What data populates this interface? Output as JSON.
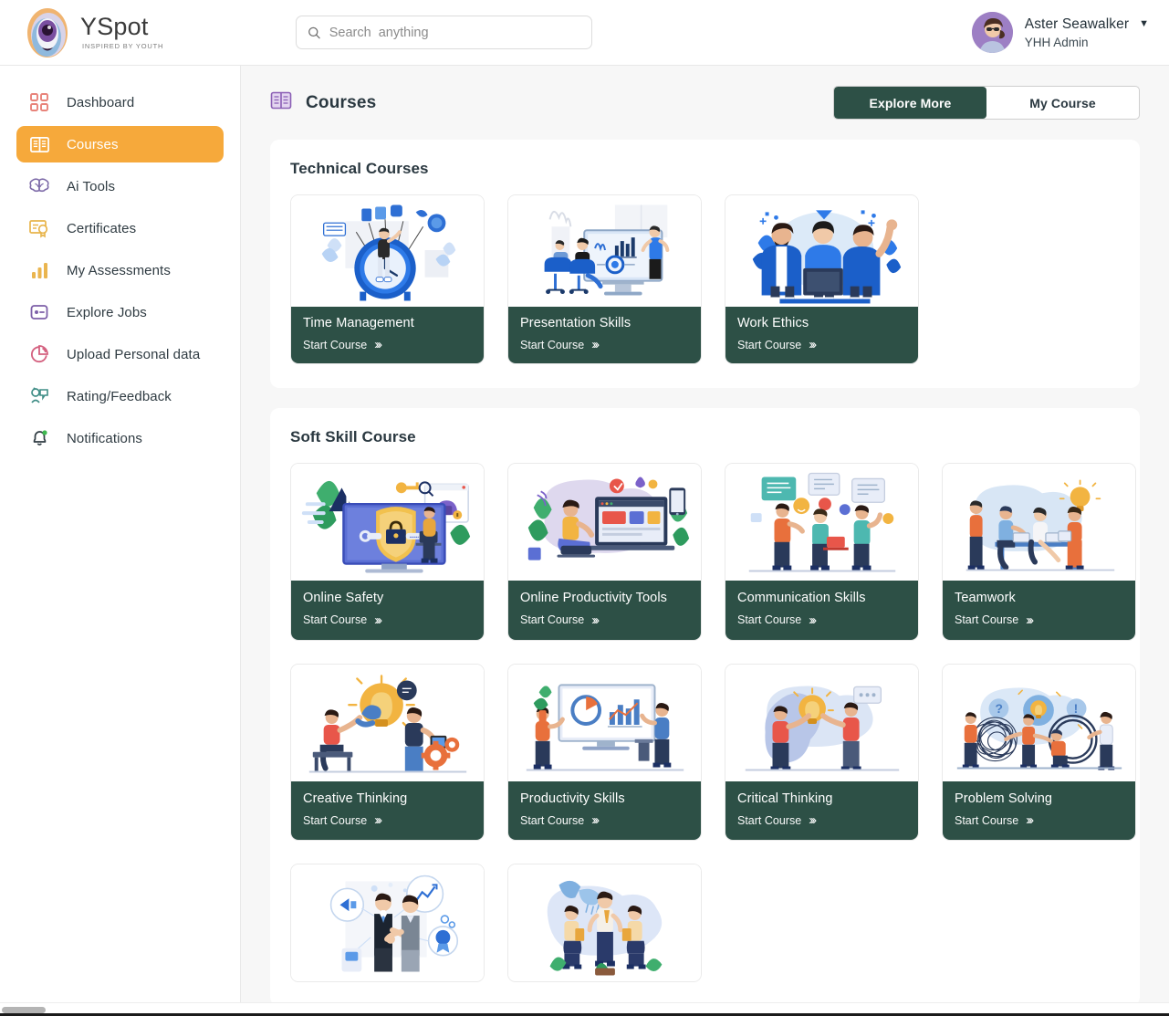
{
  "brand": {
    "name": "YSpot",
    "tagline": "INSPIRED BY YOUTH",
    "logo_icon": "yspot-eye-logo"
  },
  "search": {
    "placeholder": "Search  anything",
    "value": "",
    "icon": "search-icon"
  },
  "user": {
    "name": "Aster Seawalker",
    "role": "YHH Admin",
    "caret": "▼",
    "avatar_icon": "user-avatar"
  },
  "sidebar": {
    "items": [
      {
        "label": "Dashboard",
        "icon": "grid-squares-icon",
        "active": false,
        "color": "#e8837a"
      },
      {
        "label": "Courses",
        "icon": "open-book-icon",
        "active": true,
        "color": "#ffffff"
      },
      {
        "label": "Ai Tools",
        "icon": "brain-icon",
        "active": false,
        "color": "#7d6aa8"
      },
      {
        "label": "Certificates",
        "icon": "certificate-icon",
        "active": false,
        "color": "#e8b44a"
      },
      {
        "label": "My Assessments",
        "icon": "bar-chart-icon",
        "active": false,
        "color": "#eab54f"
      },
      {
        "label": "Explore Jobs",
        "icon": "id-card-icon",
        "active": false,
        "color": "#7d5fa8"
      },
      {
        "label": "Upload Personal data",
        "icon": "pie-chart-icon",
        "active": false,
        "color": "#d4607f"
      },
      {
        "label": "Rating/Feedback",
        "icon": "feedback-chat-icon",
        "active": false,
        "color": "#3f8d86"
      },
      {
        "label": "Notifications",
        "icon": "bell-icon",
        "active": false,
        "color": "#2f3b42"
      }
    ]
  },
  "header": {
    "title": "Courses",
    "title_icon": "open-book-icon",
    "tabs": [
      {
        "label": "Explore More",
        "active": true
      },
      {
        "label": "My Course",
        "active": false
      }
    ]
  },
  "colors": {
    "accent_orange": "#f6a93b",
    "card_footer_green": "#2d5046",
    "page_background": "#f7f7f7",
    "text_dark": "#2a3840"
  },
  "start_course_label": "Start Course",
  "start_course_chevron": "»›",
  "sections": [
    {
      "title": "Technical Courses",
      "cards": [
        {
          "title": "Time Management",
          "art": "clock-person",
          "start": "Start Course"
        },
        {
          "title": "Presentation Skills",
          "art": "presentation-monitor",
          "start": "Start Course"
        },
        {
          "title": "Work Ethics",
          "art": "team-three-people",
          "start": "Start Course"
        }
      ]
    },
    {
      "title": "Soft Skill Course",
      "cards": [
        {
          "title": "Online Safety",
          "art": "shield-monitor-lock",
          "start": "Start Course"
        },
        {
          "title": "Online Productivity Tools",
          "art": "laptop-desk-tools",
          "start": "Start Course"
        },
        {
          "title": "Communication Skills",
          "art": "people-speech-bubbles",
          "start": "Start Course"
        },
        {
          "title": "Teamwork",
          "art": "team-table-lightbulb",
          "start": "Start Course"
        },
        {
          "title": "Creative Thinking",
          "art": "lightbulb-hand-gears",
          "start": "Start Course"
        },
        {
          "title": "Productivity Skills",
          "art": "monitor-charts-people",
          "start": "Start Course"
        },
        {
          "title": "Critical Thinking",
          "art": "head-lightbulb-person",
          "start": "Start Course"
        },
        {
          "title": "Problem Solving",
          "art": "tangle-circle-people",
          "start": "Start Course"
        }
      ]
    },
    {
      "title": "",
      "partial": true,
      "cards": [
        {
          "title": "",
          "art": "handshake-business",
          "start": ""
        },
        {
          "title": "",
          "art": "watering-can-growth",
          "start": ""
        }
      ]
    }
  ]
}
